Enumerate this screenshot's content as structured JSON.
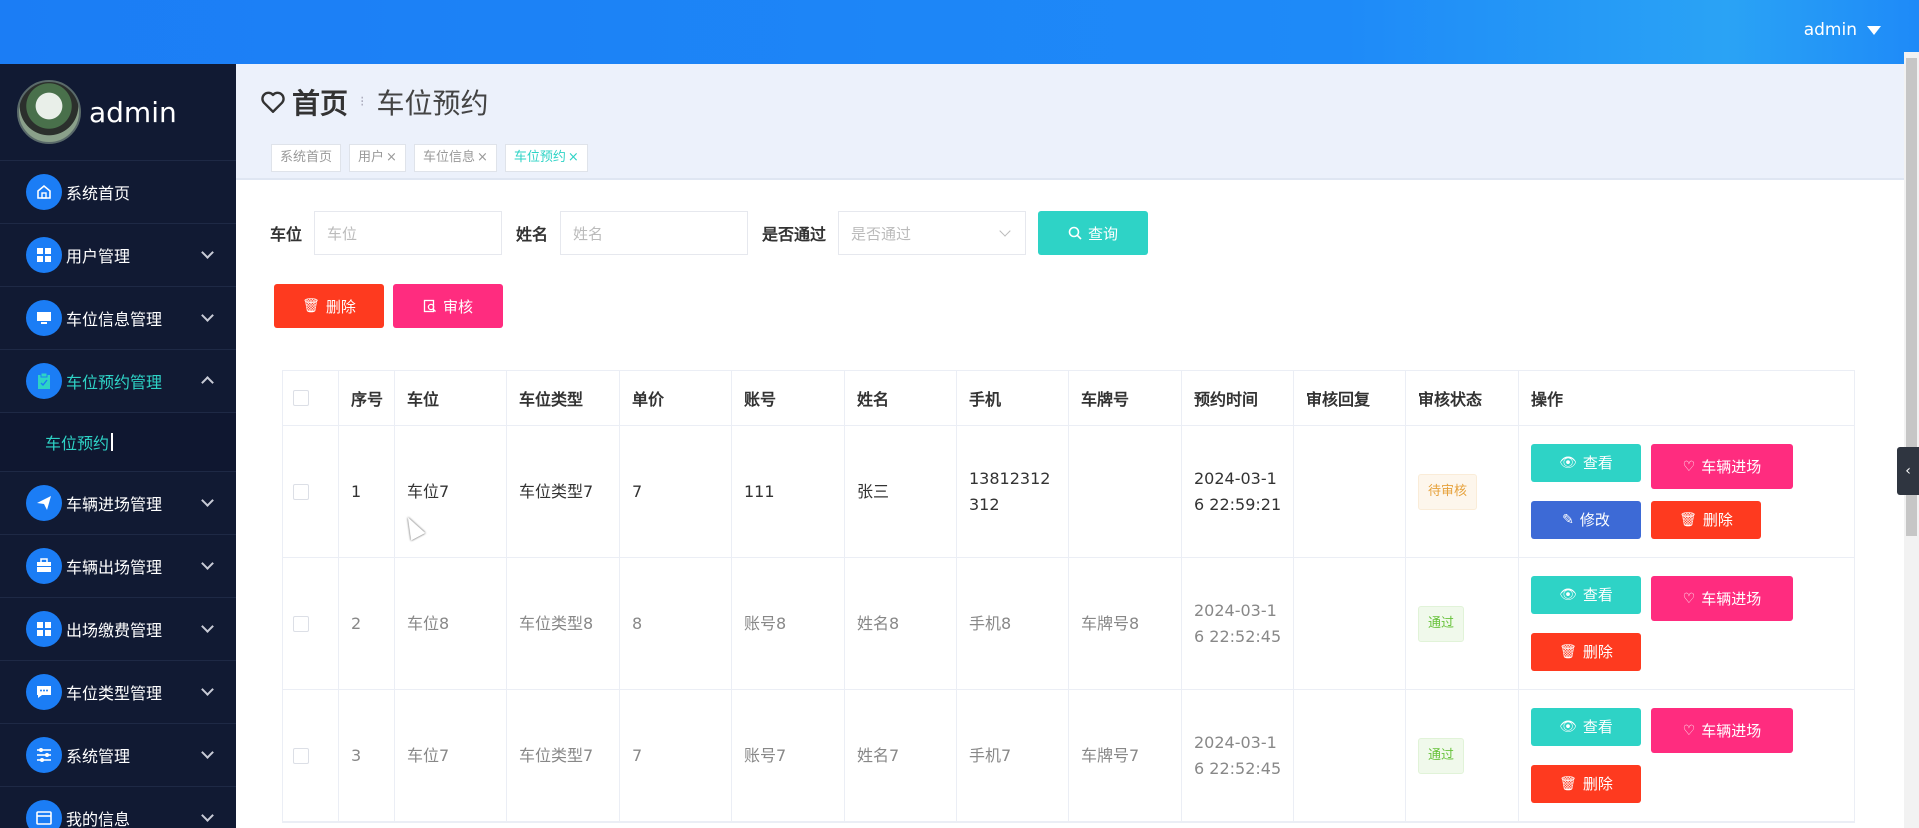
{
  "topbar": {
    "user": "admin"
  },
  "sidebar": {
    "profile_name": "admin",
    "items": [
      {
        "label": "系统首页",
        "icon": "home-icon",
        "expandable": false,
        "expanded": false,
        "active": false
      },
      {
        "label": "用户管理",
        "icon": "grid-icon",
        "expandable": true,
        "expanded": false,
        "active": false
      },
      {
        "label": "车位信息管理",
        "icon": "monitor-icon",
        "expandable": true,
        "expanded": false,
        "active": false
      },
      {
        "label": "车位预约管理",
        "icon": "clipboard-icon",
        "expandable": true,
        "expanded": true,
        "active": true
      },
      {
        "label": "车辆进场管理",
        "icon": "send-icon",
        "expandable": true,
        "expanded": false,
        "active": false
      },
      {
        "label": "车辆出场管理",
        "icon": "briefcase-icon",
        "expandable": true,
        "expanded": false,
        "active": false
      },
      {
        "label": "出场缴费管理",
        "icon": "grid-icon",
        "expandable": true,
        "expanded": false,
        "active": false
      },
      {
        "label": "车位类型管理",
        "icon": "chat-icon",
        "expandable": true,
        "expanded": false,
        "active": false
      },
      {
        "label": "系统管理",
        "icon": "sliders-icon",
        "expandable": true,
        "expanded": false,
        "active": false
      },
      {
        "label": "我的信息",
        "icon": "card-icon",
        "expandable": true,
        "expanded": false,
        "active": false
      }
    ],
    "submenu": {
      "label": "车位预约"
    }
  },
  "breadcrumb": {
    "home": "首页",
    "current": "车位预约"
  },
  "tags": [
    {
      "label": "系统首页",
      "closable": false,
      "active": false
    },
    {
      "label": "用户",
      "closable": true,
      "active": false
    },
    {
      "label": "车位信息",
      "closable": true,
      "active": false
    },
    {
      "label": "车位预约",
      "closable": true,
      "active": true
    }
  ],
  "filter": {
    "spot_label": "车位",
    "spot_placeholder": "车位",
    "name_label": "姓名",
    "name_placeholder": "姓名",
    "pass_label": "是否通过",
    "pass_placeholder": "是否通过",
    "query_label": "查询"
  },
  "toolbar": {
    "delete_label": "删除",
    "audit_label": "审核"
  },
  "table": {
    "headers": [
      "序号",
      "车位",
      "车位类型",
      "单价",
      "账号",
      "姓名",
      "手机",
      "车牌号",
      "预约时间",
      "审核回复",
      "审核状态",
      "操作"
    ],
    "rows": [
      {
        "no": "1",
        "spot": "车位7",
        "type": "车位类型7",
        "price": "7",
        "account": "111",
        "name": "张三",
        "phone": "13812312312",
        "plate": "",
        "time": "2024-03-16 22:59:21",
        "reply": "",
        "status": "待审核",
        "status_kind": "pending",
        "actions": [
          "查看",
          "车辆进场",
          "修改",
          "删除"
        ]
      },
      {
        "no": "2",
        "spot": "车位8",
        "type": "车位类型8",
        "price": "8",
        "account": "账号8",
        "name": "姓名8",
        "phone": "手机8",
        "plate": "车牌号8",
        "time": "2024-03-16 22:52:45",
        "reply": "",
        "status": "通过",
        "status_kind": "pass",
        "actions": [
          "查看",
          "车辆进场",
          "删除"
        ]
      },
      {
        "no": "3",
        "spot": "车位7",
        "type": "车位类型7",
        "price": "7",
        "account": "账号7",
        "name": "姓名7",
        "phone": "手机7",
        "plate": "车牌号7",
        "time": "2024-03-16 22:52:45",
        "reply": "",
        "status": "通过",
        "status_kind": "pass",
        "actions": [
          "查看",
          "车辆进场",
          "删除"
        ]
      }
    ]
  },
  "colors": {
    "primary": "#1b7df5",
    "teal": "#2ed3c6",
    "pink": "#ff2c7f",
    "red": "#fe3a1f",
    "blue": "#3d6ad6",
    "sidebar": "#111a33"
  }
}
